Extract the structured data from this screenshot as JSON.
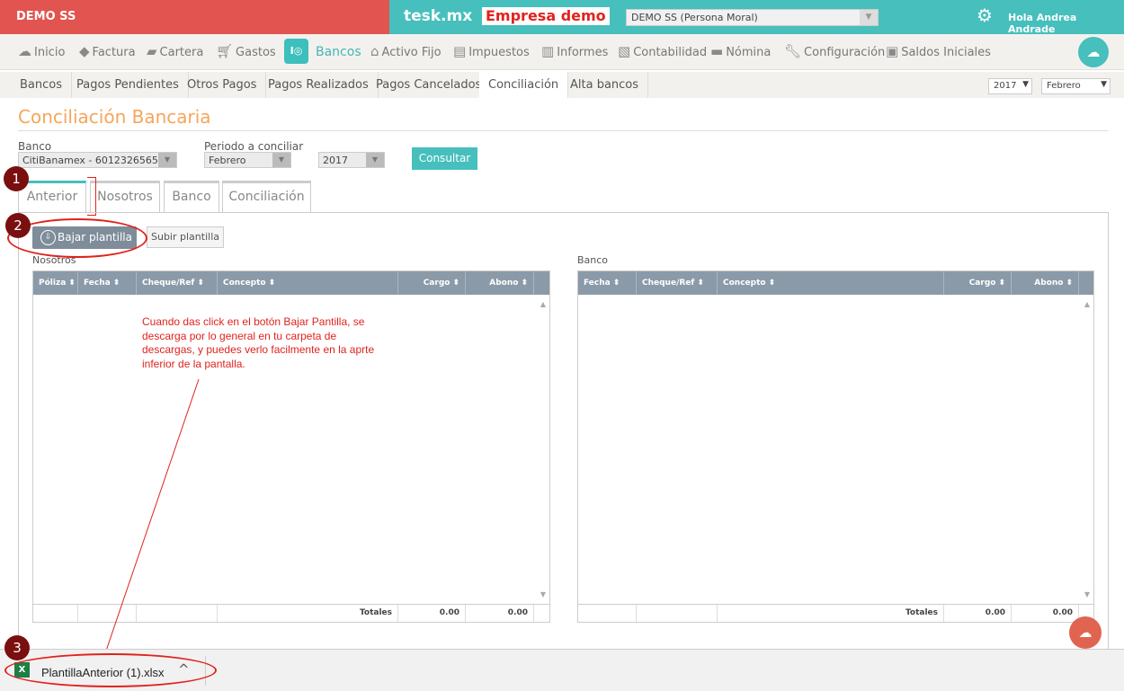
{
  "header": {
    "company": "DEMO SS",
    "brand": "tesk.mx",
    "demo_label": "Empresa demo",
    "company_select": "DEMO SS (Persona Moral)",
    "user_greeting": "Hola Andrea Andrade"
  },
  "menu": [
    {
      "label": "Inicio",
      "icon": "cloud-icon"
    },
    {
      "label": "Factura",
      "icon": "tag-icon"
    },
    {
      "label": "Cartera",
      "icon": "wallet-icon"
    },
    {
      "label": "Gastos",
      "icon": "cart-icon"
    },
    {
      "label": "Bancos",
      "icon": "safe-icon"
    },
    {
      "label": "Activo Fijo",
      "icon": "house-icon"
    },
    {
      "label": "Impuestos",
      "icon": "briefcase-icon"
    },
    {
      "label": "Informes",
      "icon": "document-icon"
    },
    {
      "label": "Contabilidad",
      "icon": "ledger-icon"
    },
    {
      "label": "Nómina",
      "icon": "card-icon"
    },
    {
      "label": "Configuración",
      "icon": "wrench-icon"
    },
    {
      "label": "Saldos Iniciales",
      "icon": "balance-icon"
    }
  ],
  "subtabs": [
    "Bancos",
    "Pagos Pendientes",
    "Otros Pagos",
    "Pagos Realizados",
    "Pagos Cancelados",
    "Conciliación",
    "Alta bancos"
  ],
  "period_year": "2017",
  "period_month": "Febrero",
  "page_title": "Conciliación Bancaria",
  "form": {
    "bank_label": "Banco",
    "bank_value": "CitiBanamex - 6012326565",
    "period_label": "Periodo a conciliar",
    "month_value": "Febrero",
    "year_value": "2017",
    "consult_button": "Consultar"
  },
  "tabs": [
    "Anterior",
    "Nosotros",
    "Banco",
    "Conciliación"
  ],
  "markers": [
    "1",
    "2",
    "3"
  ],
  "buttons": {
    "download": "Bajar plantilla",
    "upload": "Subir plantilla"
  },
  "grid_left": {
    "title": "Nosotros",
    "columns": [
      "Póliza",
      "Fecha",
      "Cheque/Ref",
      "Concepto",
      "Cargo",
      "Abono"
    ],
    "totals_label": "Totales",
    "cargo_total": "0.00",
    "abono_total": "0.00"
  },
  "grid_right": {
    "title": "Banco",
    "columns": [
      "Fecha",
      "Cheque/Ref",
      "Concepto",
      "Cargo",
      "Abono"
    ],
    "totals_label": "Totales",
    "cargo_total": "0.00",
    "abono_total": "0.00"
  },
  "annotation": "Cuando das click en el botón Bajar Pantilla, se descarga por lo general en tu carpeta de descargas, y puedes verlo facilmente en la aprte inferior de la pantalla.",
  "download_bar": {
    "filename": "PlantillaAnterior (1).xlsx",
    "icon_letter": "X"
  },
  "colors": {
    "teal": "#46bfbd",
    "red": "#e15450",
    "title_orange": "#f6a55a",
    "annotation_red": "#e0231e"
  }
}
